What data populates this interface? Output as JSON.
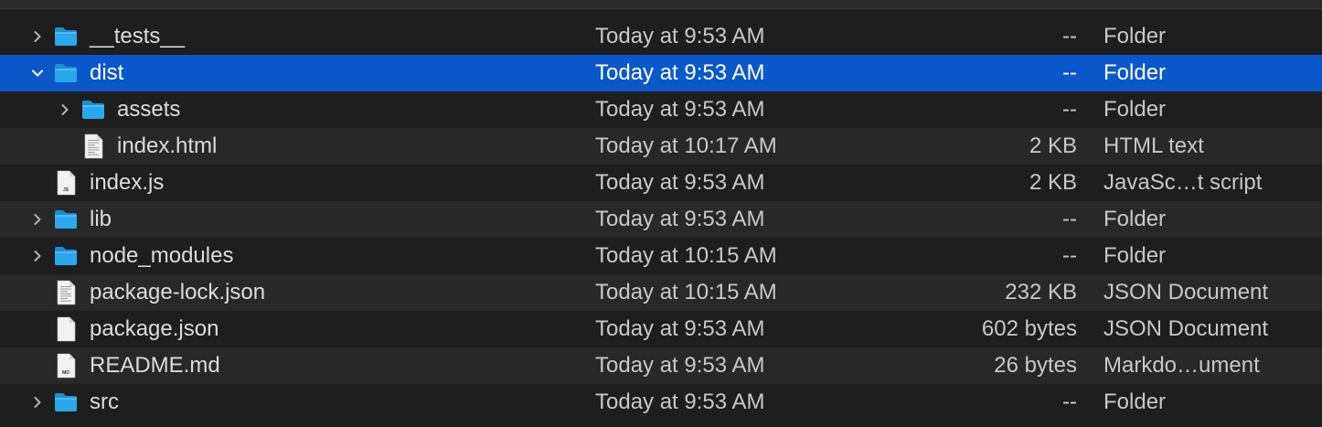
{
  "colors": {
    "background": "#1e1e1e",
    "alt_row": "#282828",
    "selection": "#0a58ca",
    "folder": "#2aa8ec"
  },
  "rows": [
    {
      "name": "__tests__",
      "date": "Today at 9:53 AM",
      "size": "--",
      "kind": "Folder",
      "icon": "folder-icon",
      "expandable": true,
      "expanded": false,
      "indent": 0,
      "selected": false
    },
    {
      "name": "dist",
      "date": "Today at 9:53 AM",
      "size": "--",
      "kind": "Folder",
      "icon": "folder-icon",
      "expandable": true,
      "expanded": true,
      "indent": 0,
      "selected": true
    },
    {
      "name": "assets",
      "date": "Today at 9:53 AM",
      "size": "--",
      "kind": "Folder",
      "icon": "folder-icon",
      "expandable": true,
      "expanded": false,
      "indent": 1,
      "selected": false
    },
    {
      "name": "index.html",
      "date": "Today at 10:17 AM",
      "size": "2 KB",
      "kind": "HTML text",
      "icon": "html-file-icon",
      "expandable": false,
      "expanded": false,
      "indent": 1,
      "selected": false
    },
    {
      "name": "index.js",
      "date": "Today at 9:53 AM",
      "size": "2 KB",
      "kind": "JavaSc…t script",
      "icon": "js-file-icon",
      "badge": "JS",
      "expandable": false,
      "expanded": false,
      "indent": 0,
      "selected": false
    },
    {
      "name": "lib",
      "date": "Today at 9:53 AM",
      "size": "--",
      "kind": "Folder",
      "icon": "folder-icon",
      "expandable": true,
      "expanded": false,
      "indent": 0,
      "selected": false
    },
    {
      "name": "node_modules",
      "date": "Today at 10:15 AM",
      "size": "--",
      "kind": "Folder",
      "icon": "folder-icon",
      "expandable": true,
      "expanded": false,
      "indent": 0,
      "selected": false
    },
    {
      "name": "package-lock.json",
      "date": "Today at 10:15 AM",
      "size": "232 KB",
      "kind": "JSON Document",
      "icon": "json-file-icon",
      "expandable": false,
      "expanded": false,
      "indent": 0,
      "selected": false
    },
    {
      "name": "package.json",
      "date": "Today at 9:53 AM",
      "size": "602 bytes",
      "kind": "JSON Document",
      "icon": "json-file-icon",
      "expandable": false,
      "expanded": false,
      "indent": 0,
      "selected": false
    },
    {
      "name": "README.md",
      "date": "Today at 9:53 AM",
      "size": "26 bytes",
      "kind": "Markdo…ument",
      "icon": "md-file-icon",
      "badge": "MD",
      "expandable": false,
      "expanded": false,
      "indent": 0,
      "selected": false
    },
    {
      "name": "src",
      "date": "Today at 9:53 AM",
      "size": "--",
      "kind": "Folder",
      "icon": "folder-icon",
      "expandable": true,
      "expanded": false,
      "indent": 0,
      "selected": false
    }
  ]
}
